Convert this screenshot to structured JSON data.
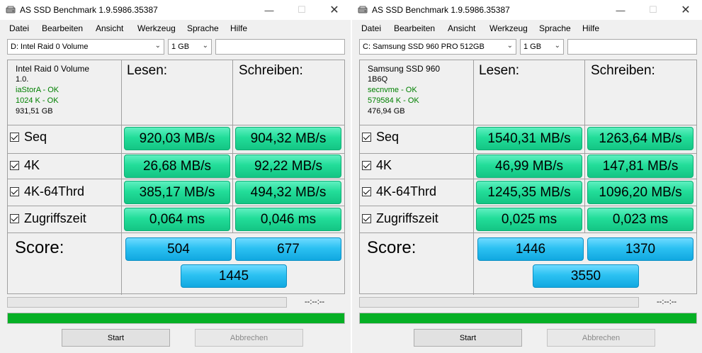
{
  "windows": [
    {
      "title": "AS SSD Benchmark 1.9.5986.35387",
      "menu": [
        "Datei",
        "Bearbeiten",
        "Ansicht",
        "Werkzeug",
        "Sprache",
        "Hilfe"
      ],
      "drive_select": "D: Intel Raid 0 Volume",
      "size_select": "1 GB",
      "info": {
        "name": "Intel Raid 0 Volume",
        "firmware": "1.0.",
        "driver": "iaStorA - OK",
        "alignment": "1024 K - OK",
        "capacity": "931,51 GB"
      },
      "headers": {
        "read": "Lesen:",
        "write": "Schreiben:"
      },
      "rows": [
        {
          "label": "Seq",
          "read": "920,03 MB/s",
          "write": "904,32 MB/s"
        },
        {
          "label": "4K",
          "read": "26,68 MB/s",
          "write": "92,22 MB/s"
        },
        {
          "label": "4K-64Thrd",
          "read": "385,17 MB/s",
          "write": "494,32 MB/s"
        },
        {
          "label": "Zugriffszeit",
          "read": "0,064 ms",
          "write": "0,046 ms"
        }
      ],
      "score_label": "Score:",
      "score": {
        "read": "504",
        "write": "677",
        "total": "1445"
      },
      "time": "--:--:--",
      "progress": 1.0,
      "buttons": {
        "start": "Start",
        "cancel": "Abbrechen"
      }
    },
    {
      "title": "AS SSD Benchmark 1.9.5986.35387",
      "menu": [
        "Datei",
        "Bearbeiten",
        "Ansicht",
        "Werkzeug",
        "Sprache",
        "Hilfe"
      ],
      "drive_select": "C: Samsung SSD 960 PRO 512GB",
      "size_select": "1 GB",
      "info": {
        "name": "Samsung SSD 960",
        "firmware": "1B6Q",
        "driver": "secnvme - OK",
        "alignment": "579584 K - OK",
        "capacity": "476,94 GB"
      },
      "headers": {
        "read": "Lesen:",
        "write": "Schreiben:"
      },
      "rows": [
        {
          "label": "Seq",
          "read": "1540,31 MB/s",
          "write": "1263,64 MB/s"
        },
        {
          "label": "4K",
          "read": "46,99 MB/s",
          "write": "147,81 MB/s"
        },
        {
          "label": "4K-64Thrd",
          "read": "1245,35 MB/s",
          "write": "1096,20 MB/s"
        },
        {
          "label": "Zugriffszeit",
          "read": "0,025 ms",
          "write": "0,023 ms"
        }
      ],
      "score_label": "Score:",
      "score": {
        "read": "1446",
        "write": "1370",
        "total": "3550"
      },
      "time": "--:--:--",
      "progress": 1.0,
      "buttons": {
        "start": "Start",
        "cancel": "Abbrechen"
      }
    }
  ],
  "icons": {
    "app": "hard-drive-icon",
    "minimize": "minimize-icon",
    "maximize": "maximize-icon",
    "close": "close-icon",
    "checkbox": "checkbox-checked-icon",
    "dropdown": "chevron-down-icon"
  },
  "colors": {
    "result_green": "#22dd99",
    "score_blue": "#2cc1f2",
    "progress_green": "#06b025"
  }
}
